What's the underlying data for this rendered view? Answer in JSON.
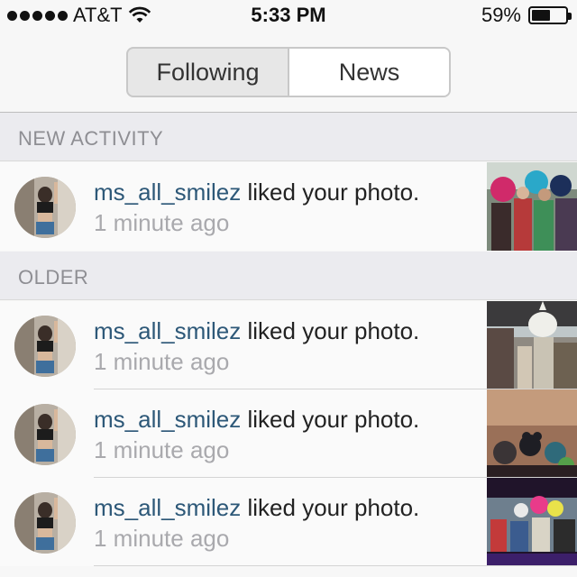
{
  "status_bar": {
    "carrier": "AT&T",
    "time": "5:33 PM",
    "battery_text": "59%",
    "battery_level": 0.59
  },
  "tabs": [
    {
      "label": "Following",
      "active": false
    },
    {
      "label": "News",
      "active": true
    }
  ],
  "sections": [
    {
      "title": "NEW ACTIVITY",
      "items": [
        {
          "username": "ms_all_smilez",
          "action": "liked your photo.",
          "time": "1 minute ago",
          "thumb": "party-crowd-icon"
        }
      ]
    },
    {
      "title": "OLDER",
      "items": [
        {
          "username": "ms_all_smilez",
          "action": "liked your photo.",
          "time": "1 minute ago",
          "thumb": "unicorn-mask-icon"
        },
        {
          "username": "ms_all_smilez",
          "action": "liked your photo.",
          "time": "1 minute ago",
          "thumb": "indoor-masks-icon"
        },
        {
          "username": "ms_all_smilez",
          "action": "liked your photo.",
          "time": "1 minute ago",
          "thumb": "festival-crowd-icon"
        }
      ]
    }
  ],
  "colors": {
    "username": "#2d5878",
    "time_text": "#a9a9ad",
    "section_bg": "#ebebef",
    "section_text": "#8e8e93"
  }
}
